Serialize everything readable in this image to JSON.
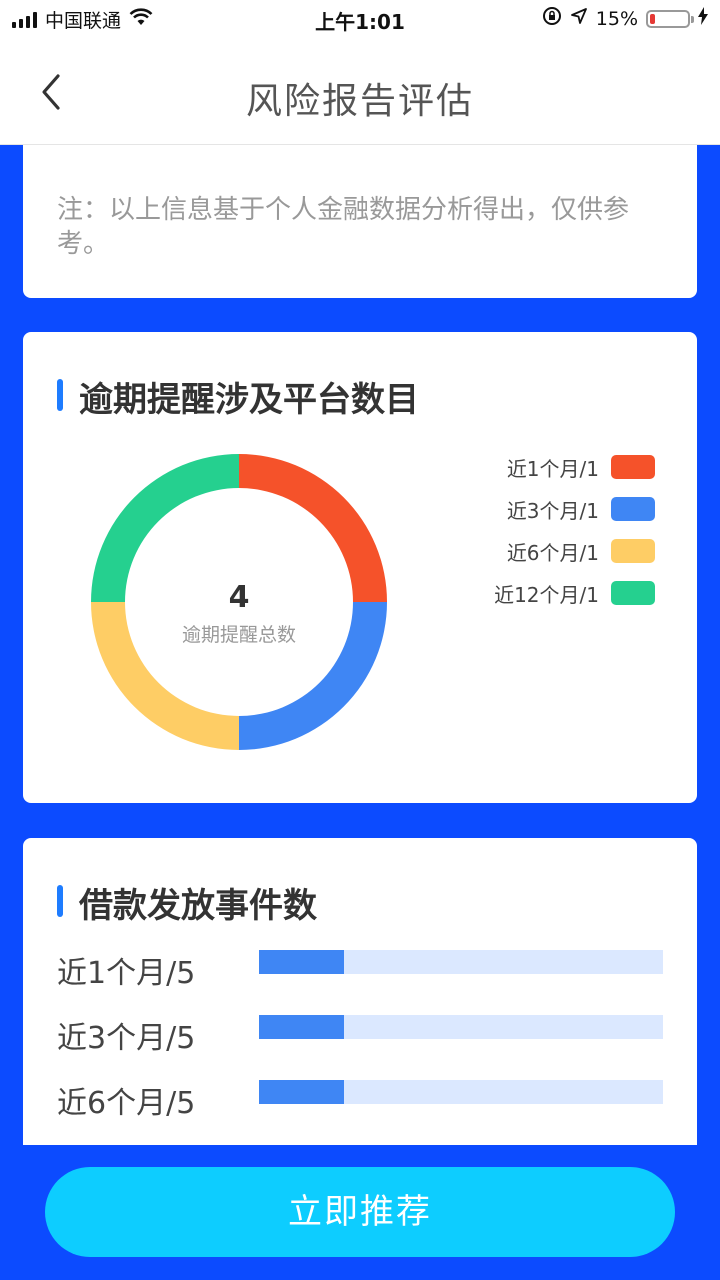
{
  "status_bar": {
    "carrier": "中国联通",
    "time": "上午1:01",
    "battery_percent": "15%",
    "icons": [
      "signal-icon",
      "wifi-icon",
      "orientation-lock-icon",
      "location-icon",
      "battery-icon",
      "charging-icon"
    ],
    "battery_level": 0.15
  },
  "nav": {
    "title": "风险报告评估",
    "back_icon": "chevron-left-icon"
  },
  "note_card": {
    "note": "注：以上信息基于个人金融数据分析得出，仅供参考。"
  },
  "overdue_card": {
    "title": "逾期提醒涉及平台数目",
    "total_value": "4",
    "total_label": "逾期提醒总数",
    "chart_data": {
      "type": "pie",
      "categories": [
        "近1个月/1",
        "近3个月/1",
        "近6个月/1",
        "近12个月/1"
      ],
      "values": [
        1,
        1,
        1,
        1
      ],
      "colors": [
        "#f5522a",
        "#3f86f4",
        "#fecd65",
        "#25d08f"
      ],
      "legend_position": "right"
    }
  },
  "loan_card": {
    "title": "借款发放事件数",
    "chart_data": {
      "type": "bar",
      "categories": [
        "近1个月/5",
        "近3个月/5",
        "近6个月/5"
      ],
      "values": [
        5,
        5,
        5
      ],
      "fill_fraction": [
        0.21,
        0.21,
        0.21
      ],
      "colors": {
        "fill": "#3f86f4",
        "track": "#dbe8ff"
      }
    }
  },
  "cta": {
    "label": "立即推荐"
  },
  "colors": {
    "page_background": "#0c4bff",
    "accent": "#1e7cff",
    "cta": "#0dcdff"
  }
}
